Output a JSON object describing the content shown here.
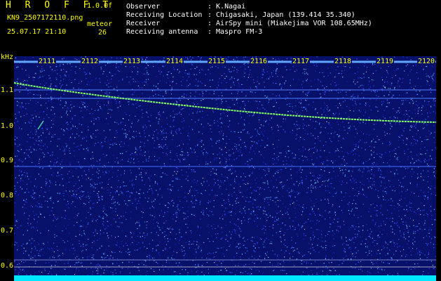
{
  "header": {
    "app_title": "H R O F F T",
    "version": "1.0.0f",
    "filename": "KN9_2507172110.png",
    "datetime": "25.07.17 21:10",
    "meteor_label": "meteor",
    "meteor_count": "26"
  },
  "info": [
    {
      "key": "Observer",
      "value": ": K.Nagai"
    },
    {
      "key": "Receiving Location",
      "value": ": Chigasaki, Japan (139.414 35.340)"
    },
    {
      "key": "Receiver",
      "value": ": AirSpy mini (Miakejima VOR 108.65MHz)"
    },
    {
      "key": "Receiving antenna",
      "value": ": Maspro FM-3"
    }
  ],
  "axis": {
    "y_unit": "kHz",
    "y_ticks": [
      "1.1",
      "1.0",
      "0.9",
      "0.8",
      "0.7",
      "0.6"
    ],
    "x_ticks": [
      "2111",
      "2112",
      "2113",
      "2114",
      "2115",
      "2116",
      "2117",
      "2118",
      "2119",
      "2120"
    ]
  },
  "colors": {
    "label": "#ffff00",
    "info_text": "#ffffff",
    "background": "#07116a",
    "trace": "#7fff60",
    "bottom_bar": "#00e8ff"
  }
}
